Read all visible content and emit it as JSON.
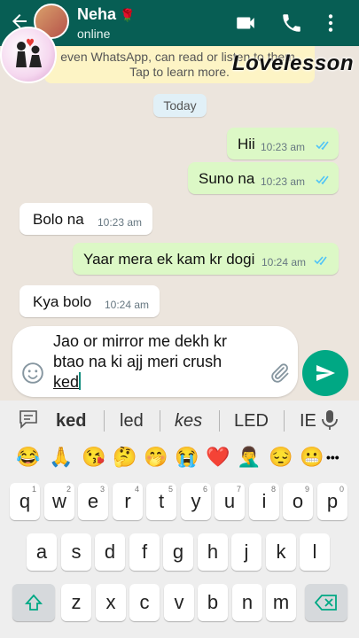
{
  "header": {
    "contact_name": "Neha",
    "status": "online",
    "rose_glyph": "🌹",
    "icons": [
      "back-arrow-icon",
      "video-call-icon",
      "phone-icon",
      "more-vert-icon"
    ],
    "color": "#075e54"
  },
  "overlay": {
    "watermark": "Lovelesson"
  },
  "chat": {
    "encryption_notice": [
      "even WhatsApp, can read or listen to them.",
      "Tap to learn more."
    ],
    "date_chip": "Today",
    "messages": [
      {
        "direction": "out",
        "text": "Hii",
        "time": "10:23 am",
        "status": "read"
      },
      {
        "direction": "out",
        "text": "Suno na",
        "time": "10:23 am",
        "status": "read"
      },
      {
        "direction": "in",
        "text": "Bolo na",
        "time": "10:23 am"
      },
      {
        "direction": "out",
        "text": "Yaar mera ek kam kr dogi",
        "time": "10:24 am",
        "status": "read"
      },
      {
        "direction": "in",
        "text": "Kya bolo",
        "time": "10:24 am"
      }
    ],
    "read_tick_color": "#4fc3f7"
  },
  "composer": {
    "draft_lines": [
      "Jao or mirror me dekh kr",
      "btao na ki ajj meri crush",
      "ked"
    ],
    "accent": "#00a884"
  },
  "keyboard": {
    "suggestions": [
      "ked",
      "led",
      "kes",
      "LED",
      "IE"
    ],
    "emojis": [
      "😂",
      "🙏",
      "😘",
      "🤔",
      "🤭",
      "😭",
      "❤️",
      "🤦‍♂️",
      "😔",
      "😬"
    ],
    "more_label": "•••",
    "rows": [
      [
        {
          "k": "q",
          "h": "1"
        },
        {
          "k": "w",
          "h": "2"
        },
        {
          "k": "e",
          "h": "3"
        },
        {
          "k": "r",
          "h": "4"
        },
        {
          "k": "t",
          "h": "5"
        },
        {
          "k": "y",
          "h": "6"
        },
        {
          "k": "u",
          "h": "7"
        },
        {
          "k": "i",
          "h": "8"
        },
        {
          "k": "o",
          "h": "9"
        },
        {
          "k": "p",
          "h": "0"
        }
      ],
      [
        {
          "k": "a"
        },
        {
          "k": "s"
        },
        {
          "k": "d"
        },
        {
          "k": "f"
        },
        {
          "k": "g"
        },
        {
          "k": "h"
        },
        {
          "k": "j"
        },
        {
          "k": "k"
        },
        {
          "k": "l"
        }
      ],
      [
        {
          "k": "z"
        },
        {
          "k": "x"
        },
        {
          "k": "c"
        },
        {
          "k": "v"
        },
        {
          "k": "b"
        },
        {
          "k": "n"
        },
        {
          "k": "m"
        }
      ]
    ]
  }
}
